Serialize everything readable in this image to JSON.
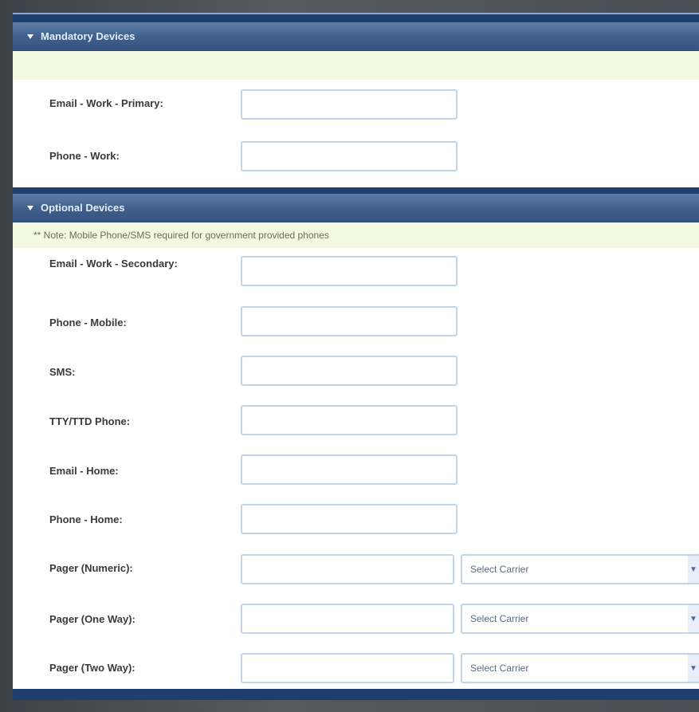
{
  "sections": {
    "mandatory": {
      "title": "Mandatory Devices",
      "fields": [
        {
          "label": "Email - Work - Primary:",
          "value": ""
        },
        {
          "label": "Phone - Work:",
          "value": ""
        }
      ]
    },
    "optional": {
      "title": "Optional Devices",
      "note": "** Note: Mobile Phone/SMS required for government provided phones",
      "fields": [
        {
          "label": "Email - Work - Secondary:",
          "value": ""
        },
        {
          "label": "Phone - Mobile:",
          "value": ""
        },
        {
          "label": "SMS:",
          "value": ""
        },
        {
          "label": "TTY/TTD Phone:",
          "value": ""
        },
        {
          "label": "Email - Home:",
          "value": ""
        },
        {
          "label": "Phone - Home:",
          "value": ""
        },
        {
          "label": "Pager (Numeric):",
          "value": "",
          "carrier": "Select Carrier"
        },
        {
          "label": "Pager (One Way):",
          "value": "",
          "carrier": "Select Carrier"
        },
        {
          "label": "Pager (Two Way):",
          "value": "",
          "carrier": "Select Carrier"
        }
      ]
    }
  },
  "icons": {
    "collapse": "caret-down-icon",
    "dropdown": "chevron-down-icon"
  },
  "colors": {
    "header": "#3e5f8c",
    "note_background": "#f3f8e0",
    "field_border": "#c4d4e8"
  }
}
